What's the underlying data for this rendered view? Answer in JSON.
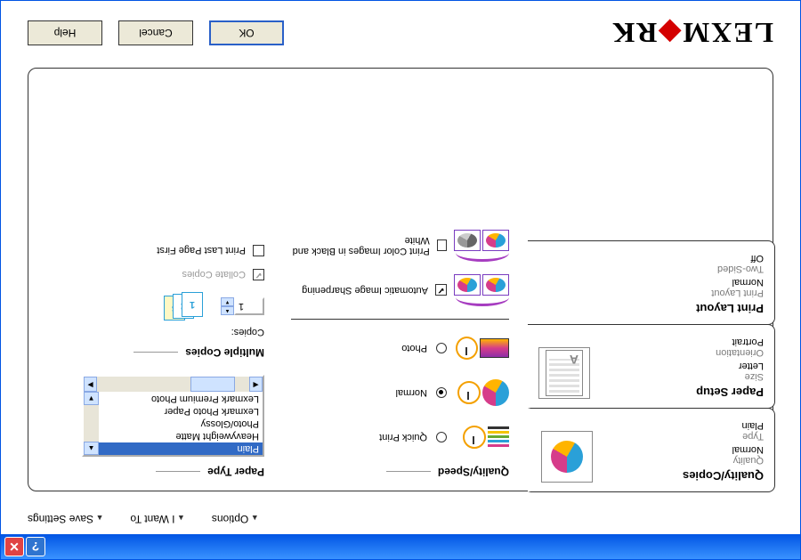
{
  "titlebar": {
    "help": "?",
    "close": "✕"
  },
  "menus": {
    "options": "Options",
    "iwant": "I Want To",
    "save": "Save Settings"
  },
  "tabs": {
    "quality": {
      "title": "Quality/Copies",
      "quality_label": "Quality",
      "quality_value": "Normal",
      "type_label": "Type",
      "type_value": "Plain"
    },
    "paper": {
      "title": "Paper Setup",
      "size_label": "Size",
      "size_value": "Letter",
      "orient_label": "Orientation",
      "orient_value": "Portrait"
    },
    "layout": {
      "title": "Print Layout",
      "layout_label": "Print Layout",
      "layout_value": "Normal",
      "twosided_label": "Two-Sided",
      "twosided_value": "Off"
    }
  },
  "quality_speed": {
    "title": "Quality/Speed",
    "quick": "Quick Print",
    "normal": "Normal",
    "photo": "Photo"
  },
  "enhance": {
    "sharpen": "Automatic Image Sharpening",
    "bw": "Print Color Images in Black and White"
  },
  "paper_type": {
    "title": "Paper Type",
    "items": [
      "Plain",
      "Heavyweight Matte",
      "Photo/Glossy",
      "Lexmark Photo Paper",
      "Lexmark Premium Photo"
    ]
  },
  "copies": {
    "title": "Multiple Copies",
    "label": "Copies:",
    "value": "1",
    "collate": "Collate Copies",
    "lastfirst": "Print Last Page First"
  },
  "buttons": {
    "ok": "OK",
    "cancel": "Cancel",
    "help": "Help"
  },
  "logo": {
    "l1": "LEXM",
    "l2": "RK"
  }
}
